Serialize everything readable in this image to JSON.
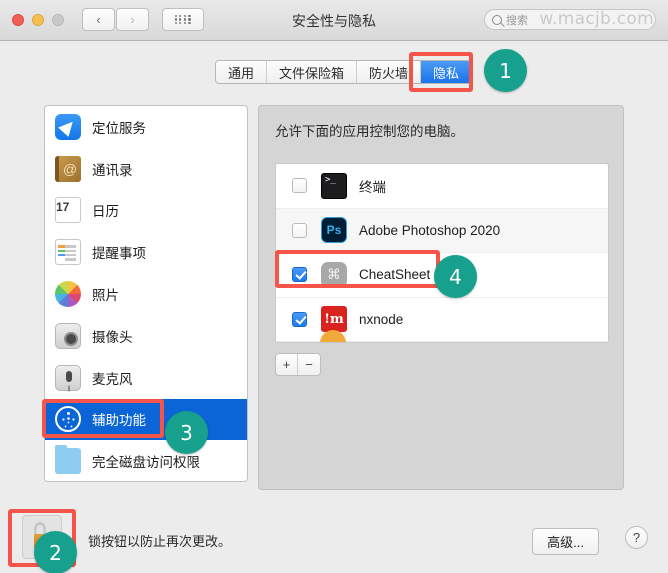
{
  "window": {
    "title": "安全性与隐私",
    "traffic_lights": [
      "close",
      "minimize",
      "zoom"
    ],
    "nav": {
      "back": "‹",
      "forward": "›",
      "show_all": "grid-icon"
    }
  },
  "search": {
    "placeholder": "搜索",
    "watermark": "w.macjb.com"
  },
  "tabs": [
    {
      "label": "通用",
      "selected": false
    },
    {
      "label": "文件保险箱",
      "selected": false
    },
    {
      "label": "防火墙",
      "selected": false
    },
    {
      "label": "隐私",
      "selected": true
    }
  ],
  "sidebar": {
    "items": [
      {
        "label": "定位服务",
        "icon": "location-services-icon",
        "selected": false
      },
      {
        "label": "通讯录",
        "icon": "contacts-icon",
        "selected": false
      },
      {
        "label": "日历",
        "icon": "calendar-icon",
        "selected": false,
        "day": "17"
      },
      {
        "label": "提醒事项",
        "icon": "reminders-icon",
        "selected": false
      },
      {
        "label": "照片",
        "icon": "photos-icon",
        "selected": false
      },
      {
        "label": "摄像头",
        "icon": "camera-icon",
        "selected": false
      },
      {
        "label": "麦克风",
        "icon": "microphone-icon",
        "selected": false
      },
      {
        "label": "辅助功能",
        "icon": "accessibility-icon",
        "selected": true
      },
      {
        "label": "完全磁盘访问权限",
        "icon": "folder-icon",
        "selected": false
      }
    ]
  },
  "main": {
    "description": "允许下面的应用控制您的电脑。",
    "apps": [
      {
        "name": "终端",
        "icon": "terminal-icon",
        "checked": false
      },
      {
        "name": "Adobe Photoshop 2020",
        "icon": "photoshop-icon",
        "checked": false
      },
      {
        "name": "CheatSheet",
        "icon": "cheatsheet-icon",
        "checked": true
      },
      {
        "name": "nxnode",
        "icon": "nxnode-icon",
        "checked": true
      }
    ],
    "add_label": "+",
    "remove_label": "−"
  },
  "bottom": {
    "lock_icon": "unlocked-padlock-icon",
    "lock_message": "锁按钮以防止再次更改。",
    "advanced_label": "高级...",
    "help_label": "?"
  },
  "annotations": {
    "accent_red": "#f4544a",
    "badge_color": "#17a08d",
    "badges": [
      {
        "number": "1",
        "target": "privacy-tab"
      },
      {
        "number": "2",
        "target": "lock-button"
      },
      {
        "number": "3",
        "target": "sidebar-item-accessibility"
      },
      {
        "number": "4",
        "target": "app-row-cheatsheet"
      }
    ]
  }
}
